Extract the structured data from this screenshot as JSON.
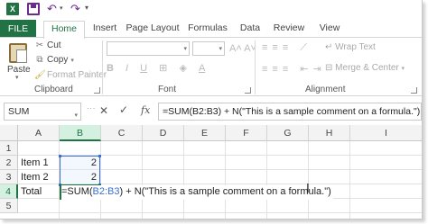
{
  "app": {
    "logo_letter": "X",
    "accent_color": "#217346"
  },
  "quick_access": {
    "save_icon": "save-icon",
    "undo_icon": "undo-icon",
    "redo_icon": "redo-icon"
  },
  "tabs": [
    "FILE",
    "Home",
    "Insert",
    "Page Layout",
    "Formulas",
    "Data",
    "Review",
    "View"
  ],
  "active_tab": "Home",
  "ribbon": {
    "clipboard": {
      "paste_label": "Paste",
      "cut_label": "Cut",
      "copy_label": "Copy",
      "format_painter_label": "Format Painter",
      "group_label": "Clipboard"
    },
    "font": {
      "group_label": "Font",
      "font_name": "",
      "font_size": ""
    },
    "alignment": {
      "wrap_text_label": "Wrap Text",
      "merge_center_label": "Merge & Center",
      "group_label": "Alignment"
    }
  },
  "formula_bar": {
    "name_box": "SUM",
    "fx_label": "fx",
    "formula": "=SUM(B2:B3) + N(\"This is a sample comment on a formula.\")"
  },
  "grid": {
    "columns": [
      "A",
      "B",
      "C",
      "D",
      "E",
      "F",
      "G",
      "H",
      "I"
    ],
    "rows": [
      "1",
      "2",
      "3",
      "4",
      "5"
    ],
    "active_column": "B",
    "active_row": "4",
    "cells": {
      "A2": "Item 1",
      "B2": "2",
      "A3": "Item 2",
      "B3": "2",
      "A4": "Total"
    },
    "edit": {
      "prefix": "=SUM(",
      "range": "B2:B3",
      "suffix": ") + N(\"This is a sample comment on a formula.\")"
    },
    "colors": {
      "reference": "#3b6fd1",
      "header_active_bg": "#d3f0e0"
    }
  }
}
